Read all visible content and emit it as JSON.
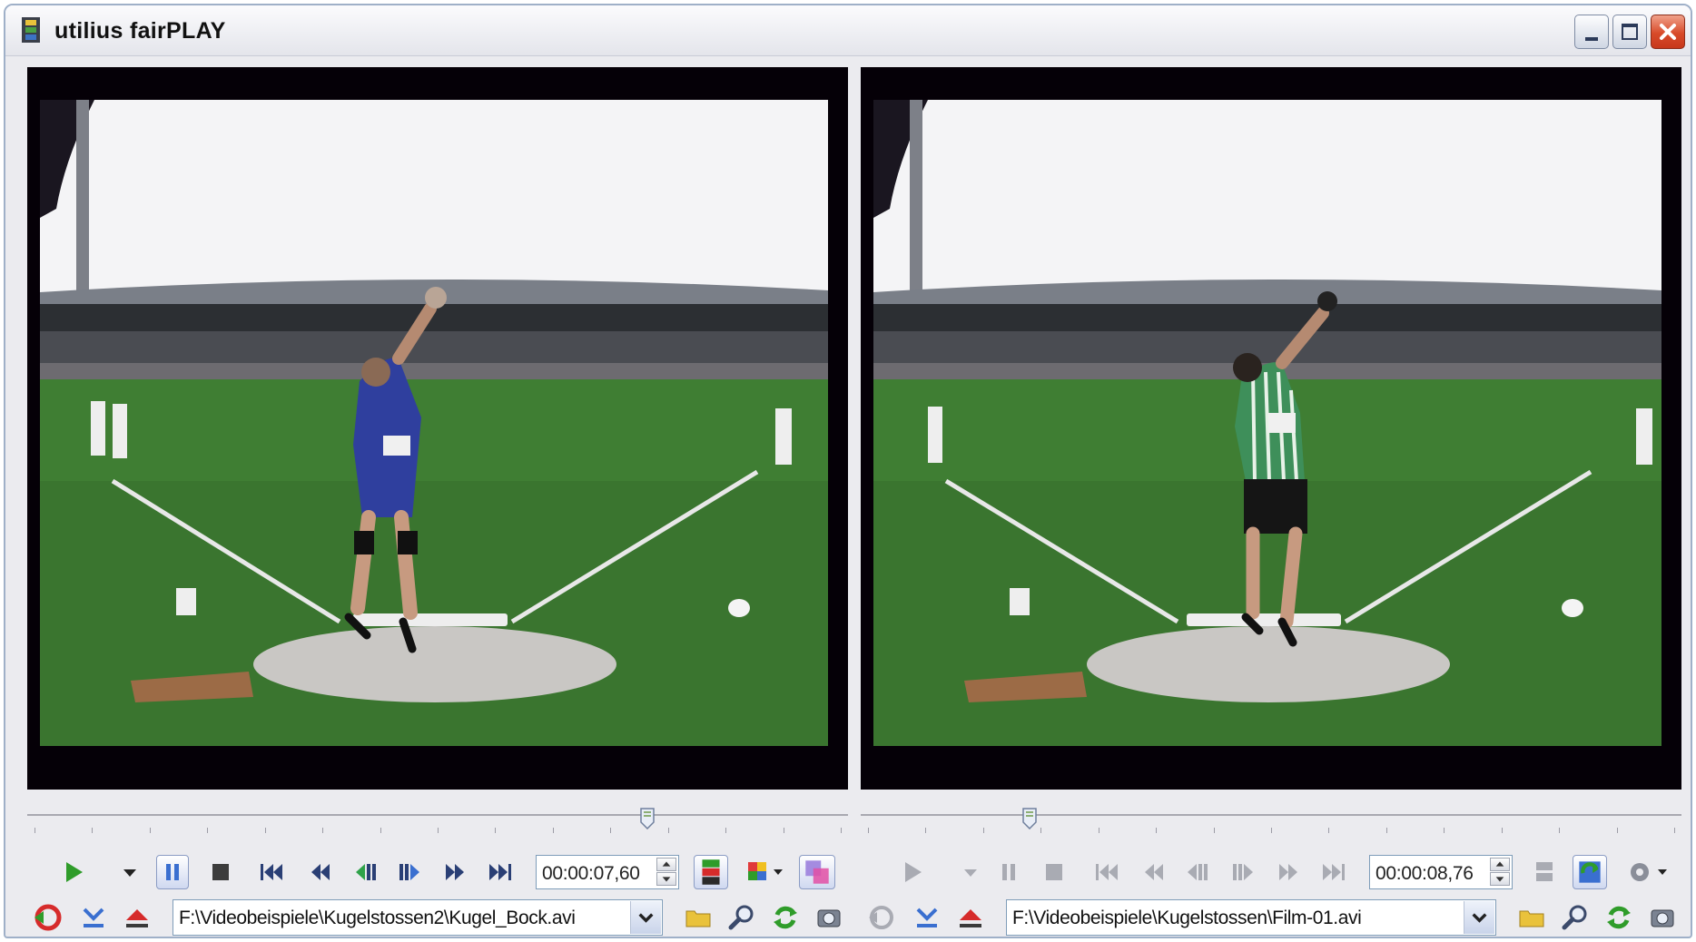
{
  "window": {
    "title": "utilius fairPLAY",
    "title_icon": "film-strip-icon",
    "controls": [
      "minimize-icon",
      "maximize-icon",
      "close-icon"
    ]
  },
  "left_player": {
    "time": "00:00:07,60",
    "file_path": "F:\\Videobeispiele\\Kugelstossen2\\Kugel_Bock.avi",
    "position": 0.76,
    "playing": false,
    "paused": true,
    "video_description_icon": "shot-put-video-frame"
  },
  "right_player": {
    "time": "00:00:08,76",
    "file_path": "F:\\Videobeispiele\\Kugelstossen\\Film-01.avi",
    "position": 0.2,
    "enabled": false
  },
  "icons": {
    "play": "play-icon",
    "play_menu": "chevron-down-icon",
    "pause": "pause-icon",
    "stop": "stop-icon",
    "to_start": "skip-to-start-icon",
    "rewind": "rewind-icon",
    "step_back": "step-back-icon",
    "step_forward": "step-forward-icon",
    "fast_forward": "fast-forward-icon",
    "to_end": "skip-to-end-icon",
    "layout": "layout-icon",
    "color": "color-palette-icon",
    "overlay": "overlay-icon",
    "sync": "sync-icon",
    "mark_in": "mark-in-icon",
    "eject": "eject-icon",
    "open_folder": "folder-icon",
    "zoom": "magnifier-icon",
    "refresh": "refresh-icon",
    "snapshot": "camera-icon",
    "settings": "gear-icon"
  },
  "colors": {
    "accent_play": "#2f9c2a",
    "pane_background": "#050007",
    "window_background": "#ebebef",
    "close_button": "#d84b2a"
  }
}
